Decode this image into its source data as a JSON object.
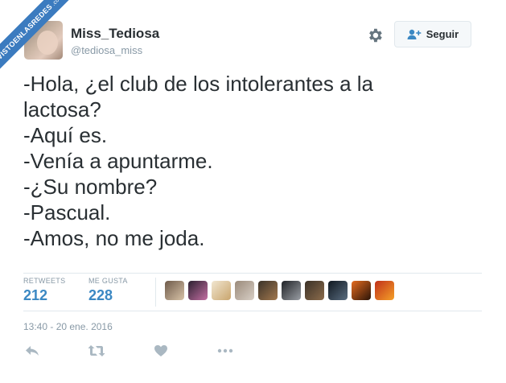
{
  "watermark": {
    "main": "VISTOENLASREDES",
    "sub": ".com"
  },
  "profile": {
    "display_name": "Miss_Tediosa",
    "handle": "@tediosa_miss"
  },
  "header": {
    "settings_icon": "gear-icon",
    "follow_icon": "add-user-icon",
    "follow_label": "Seguir"
  },
  "tweet": {
    "lines": [
      "-Hola, ¿el club de los intolerantes a la",
      "lactosa?",
      "-Aquí es.",
      "-Venía a apuntarme.",
      "-¿Su nombre?",
      "-Pascual.",
      "-Amos, no me joda."
    ]
  },
  "stats": {
    "retweets_label": "RETWEETS",
    "retweets_value": "212",
    "likes_label": "ME GUSTA",
    "likes_value": "228"
  },
  "likers": [
    {
      "colors": [
        "#6e5a4a",
        "#d8c3a8"
      ]
    },
    {
      "colors": [
        "#2b2130",
        "#c46fa3"
      ]
    },
    {
      "colors": [
        "#f1e6d0",
        "#c9a56e"
      ]
    },
    {
      "colors": [
        "#9a8a7a",
        "#d8cfc6"
      ]
    },
    {
      "colors": [
        "#3b3329",
        "#a2784e"
      ]
    },
    {
      "colors": [
        "#1f2226",
        "#9a9ea4"
      ]
    },
    {
      "colors": [
        "#3a3127",
        "#8c6c4c"
      ]
    },
    {
      "colors": [
        "#101820",
        "#5a6d80"
      ]
    },
    {
      "colors": [
        "#e56b1f",
        "#2a1408"
      ]
    },
    {
      "colors": [
        "#c0301a",
        "#f5a028"
      ]
    }
  ],
  "timestamp": "13:40 - 20 ene. 2016",
  "actions": {
    "reply_icon": "reply-icon",
    "retweet_icon": "retweet-icon",
    "like_icon": "heart-icon",
    "more_icon": "more-icon"
  },
  "colors": {
    "link_blue": "#3b88c3",
    "muted_gray": "#8899a6",
    "text": "#292f33",
    "watermark_blue": "#3b7bbf"
  }
}
